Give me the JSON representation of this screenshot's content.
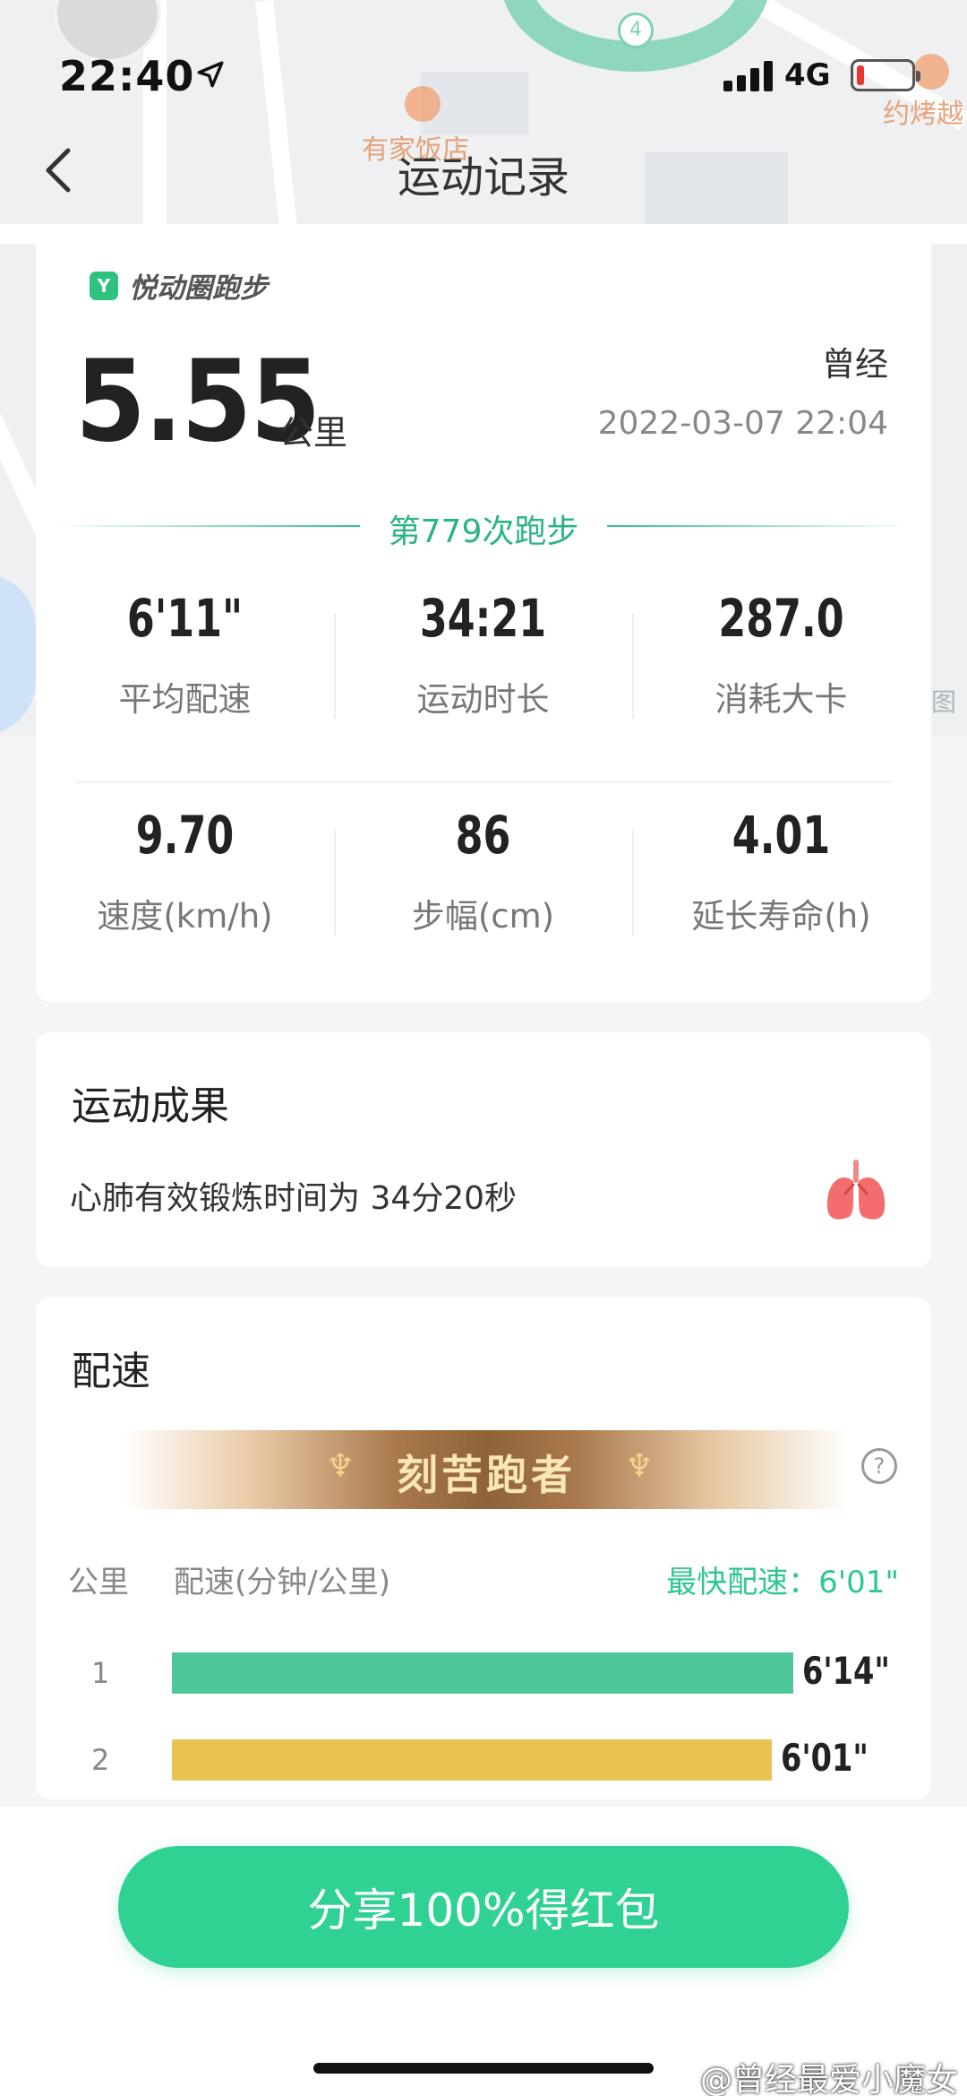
{
  "status_bar": {
    "time": "22:40",
    "network": "4G"
  },
  "map": {
    "poi_restaurant": "有家饭店",
    "poi_bbq": "约烤越",
    "route_marker": "4",
    "corner_label": "图"
  },
  "header": {
    "title": "运动记录"
  },
  "summary": {
    "brand": "悦动圈跑步",
    "distance": "5.55",
    "distance_unit": "公里",
    "username": "曾经",
    "datetime": "2022-03-07 22:04",
    "run_count": "第779次跑步",
    "stats": [
      {
        "value": "6'11\"",
        "label": "平均配速"
      },
      {
        "value": "34:21",
        "label": "运动时长"
      },
      {
        "value": "287.0",
        "label": "消耗大卡"
      },
      {
        "value": "9.70",
        "label": "速度(km/h)"
      },
      {
        "value": "86",
        "label": "步幅(cm)"
      },
      {
        "value": "4.01",
        "label": "延长寿命(h)"
      }
    ]
  },
  "result": {
    "title": "运动成果",
    "text": "心肺有效锻炼时间为 34分20秒"
  },
  "pace": {
    "title": "配速",
    "badge": "刻苦跑者",
    "col_km": "公里",
    "col_pace": "配速(分钟/公里)",
    "fastest": "最快配速：6'01\"",
    "splits": [
      {
        "km": "1",
        "pace": "6'14\"",
        "seconds": 374,
        "color": "#4ec89a"
      },
      {
        "km": "2",
        "pace": "6'01\"",
        "seconds": 361,
        "color": "#e9c452"
      }
    ]
  },
  "share": {
    "label": "分享100%得红包"
  },
  "watermark": "@曾经最爱小魔女",
  "colors": {
    "accent": "#2fd292",
    "accent_text": "#2ab486"
  }
}
